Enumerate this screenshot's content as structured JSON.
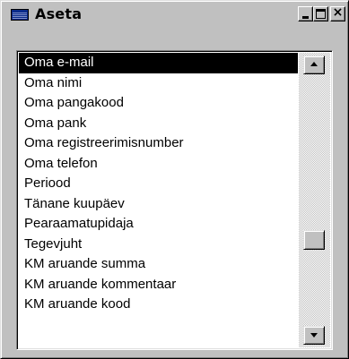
{
  "window": {
    "title": "Aseta",
    "icon": "window-icon",
    "controls": {
      "minimize": "minimize-icon",
      "maximize": "maximize-icon",
      "close": "×"
    }
  },
  "list": {
    "selected_index": 0,
    "items": [
      "Oma e-mail",
      "Oma nimi",
      "Oma pangakood",
      "Oma pank",
      "Oma registreerimisnumber",
      "Oma telefon",
      "Periood",
      "Tänane kuupäev",
      "Pearaamatupidaja",
      "Tegevjuht",
      "KM aruande summa",
      "KM aruande kommentaar",
      "KM aruande kood"
    ]
  },
  "scrollbar": {
    "up_icon": "arrow-up-icon",
    "down_icon": "arrow-down-icon",
    "position": 0.68
  },
  "colors": {
    "face": "#c0c0c0",
    "selection": "#000000",
    "selection_text": "#ffffff"
  }
}
